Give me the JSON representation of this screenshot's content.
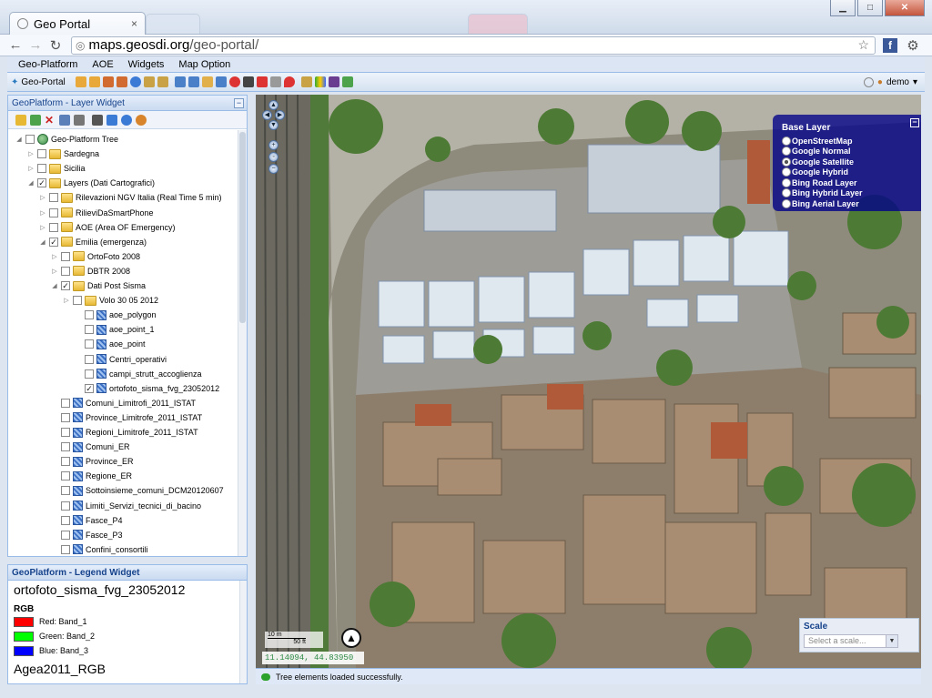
{
  "browser": {
    "tab_title": "Geo Portal",
    "tab_close": "×",
    "url_domain": "maps.geosdi.org",
    "url_path": "/geo-portal/",
    "facebook_label": "f"
  },
  "menu": {
    "items": [
      "Geo-Platform",
      "AOE",
      "Widgets",
      "Map Option"
    ]
  },
  "toolbar": {
    "brand": "Geo-Portal",
    "user": "demo"
  },
  "layer_widget": {
    "title": "GeoPlatform - Layer Widget",
    "nodes": [
      {
        "label": "Geo-Platform Tree",
        "checked": false
      },
      {
        "label": "Sardegna",
        "checked": false
      },
      {
        "label": "Sicilia",
        "checked": false
      },
      {
        "label": "Layers (Dati Cartografici)",
        "checked": true
      },
      {
        "label": "Rilevazioni NGV Italia (Real Time 5 min)",
        "checked": false
      },
      {
        "label": "RilieviDaSmartPhone",
        "checked": false
      },
      {
        "label": "AOE (Area OF Emergency)",
        "checked": false
      },
      {
        "label": "Emilia (emergenza)",
        "checked": true
      },
      {
        "label": "OrtoFoto 2008",
        "checked": false
      },
      {
        "label": "DBTR 2008",
        "checked": false
      },
      {
        "label": "Dati Post Sisma",
        "checked": true
      },
      {
        "label": "Volo 30 05 2012",
        "checked": false
      },
      {
        "label": "aoe_polygon",
        "checked": false
      },
      {
        "label": "aoe_point_1",
        "checked": false
      },
      {
        "label": "aoe_point",
        "checked": false
      },
      {
        "label": "Centri_operativi",
        "checked": false
      },
      {
        "label": "campi_strutt_accoglienza",
        "checked": false
      },
      {
        "label": "ortofoto_sisma_fvg_23052012",
        "checked": true
      },
      {
        "label": "Comuni_Limitrofi_2011_ISTAT",
        "checked": false
      },
      {
        "label": "Province_Limitrofe_2011_ISTAT",
        "checked": false
      },
      {
        "label": "Regioni_Limitrofe_2011_ISTAT",
        "checked": false
      },
      {
        "label": "Comuni_ER",
        "checked": false
      },
      {
        "label": "Province_ER",
        "checked": false
      },
      {
        "label": "Regione_ER",
        "checked": false
      },
      {
        "label": "Sottoinsieme_comuni_DCM20120607",
        "checked": false
      },
      {
        "label": "Limiti_Servizi_tecnici_di_bacino",
        "checked": false
      },
      {
        "label": "Fasce_P4",
        "checked": false
      },
      {
        "label": "Fasce_P3",
        "checked": false
      },
      {
        "label": "Confini_consortili",
        "checked": false
      }
    ]
  },
  "legend_widget": {
    "title": "GeoPlatform - Legend Widget",
    "layer_name": "ortofoto_sisma_fvg_23052012",
    "mode": "RGB",
    "bands": [
      {
        "channel": "Red:",
        "band": "Band_1",
        "color": "#ff0000"
      },
      {
        "channel": "Green:",
        "band": "Band_2",
        "color": "#00ff00"
      },
      {
        "channel": "Blue:",
        "band": "Band_3",
        "color": "#0000ff"
      }
    ],
    "next_layer": "Agea2011_RGB"
  },
  "base_layer": {
    "title": "Base Layer",
    "minimize": "−",
    "options": [
      {
        "label": "OpenStreetMap",
        "selected": false
      },
      {
        "label": "Google Normal",
        "selected": false
      },
      {
        "label": "Google Satellite",
        "selected": true
      },
      {
        "label": "Google Hybrid",
        "selected": false
      },
      {
        "label": "Bing Road Layer",
        "selected": false
      },
      {
        "label": "Bing Hybrid Layer",
        "selected": false
      },
      {
        "label": "Bing Aerial Layer",
        "selected": false
      }
    ]
  },
  "scale": {
    "title": "Scale",
    "placeholder": "Select a scale..."
  },
  "scale_bar": {
    "top": "10 m",
    "bottom": "50 ft"
  },
  "coordinates": "11.14094, 44.83950",
  "status_message": "Tree elements loaded successfully.",
  "colors": {
    "accent": "#15428b",
    "panel_border": "#99bbe8",
    "status_ok": "#2ca12c"
  }
}
